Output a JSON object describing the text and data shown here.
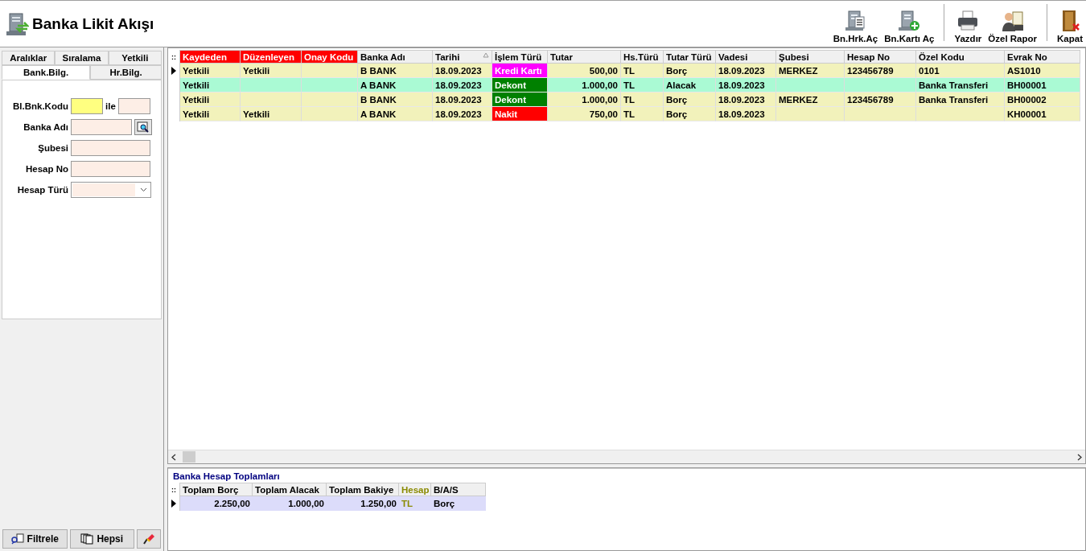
{
  "window": {
    "title": "Banka Likit Akışı"
  },
  "toolbar_groups": [
    [
      {
        "label": "Bn.Hrk.Aç",
        "kind": "bank"
      },
      {
        "label": "Bn.Kartı Aç",
        "kind": "bank-add"
      }
    ],
    [
      {
        "label": "Yazdır",
        "kind": "printer"
      },
      {
        "label": "Özel Rapor",
        "kind": "report"
      }
    ],
    [
      {
        "label": "Kapat",
        "kind": "door"
      }
    ]
  ],
  "sidebar": {
    "tabs_back": [
      {
        "label": "Aralıklar",
        "selected": false
      },
      {
        "label": "Sıralama",
        "selected": false
      },
      {
        "label": "Yetkili",
        "selected": false
      }
    ],
    "tabs_front": [
      {
        "label": "Bank.Bilg.",
        "selected": true
      },
      {
        "label": "Hr.Bilg.",
        "selected": false
      }
    ],
    "fields": [
      {
        "label": "Bl.Bnk.Kodu",
        "kind": "range",
        "joiner": "ile",
        "focused": true
      },
      {
        "label": "Banka Adı",
        "kind": "lookup",
        "focused": false
      },
      {
        "label": "Şubesi",
        "kind": "text",
        "focused": false
      },
      {
        "label": "Hesap No",
        "kind": "text",
        "focused": false
      },
      {
        "label": "Hesap Türü",
        "kind": "select",
        "focused": false
      }
    ],
    "buttons": [
      {
        "label": "Filtrele",
        "kind": "filter"
      },
      {
        "label": "Hepsi",
        "kind": "pages"
      },
      {
        "kind": "eraser"
      }
    ]
  },
  "table": {
    "corner": "::",
    "columns": [
      {
        "label": "Kaydeden",
        "flagged": true,
        "sorted": false,
        "kind": "text"
      },
      {
        "label": "Düzenleyen",
        "flagged": true,
        "sorted": false,
        "kind": "text"
      },
      {
        "label": "Onay Kodu",
        "flagged": true,
        "sorted": false,
        "kind": "text"
      },
      {
        "label": "Banka Adı",
        "flagged": false,
        "sorted": false,
        "kind": "text"
      },
      {
        "label": "Tarihi",
        "flagged": false,
        "sorted": true,
        "kind": "text"
      },
      {
        "label": "İşlem Türü",
        "flagged": false,
        "sorted": false,
        "kind": "tag"
      },
      {
        "label": "Tutar",
        "flagged": false,
        "sorted": false,
        "kind": "number"
      },
      {
        "label": "Hs.Türü",
        "flagged": false,
        "sorted": false,
        "kind": "text"
      },
      {
        "label": "Tutar Türü",
        "flagged": false,
        "sorted": false,
        "kind": "text"
      },
      {
        "label": "Vadesi",
        "flagged": false,
        "sorted": false,
        "kind": "text"
      },
      {
        "label": "Şubesi",
        "flagged": false,
        "sorted": false,
        "kind": "text"
      },
      {
        "label": "Hesap No",
        "flagged": false,
        "sorted": false,
        "kind": "text"
      },
      {
        "label": "Özel Kodu",
        "flagged": false,
        "sorted": false,
        "kind": "text"
      },
      {
        "label": "Evrak No",
        "flagged": false,
        "sorted": false,
        "kind": "text"
      }
    ],
    "rows": [
      {
        "selected": true,
        "color": "#f2f2bb",
        "cells": [
          "Yetkili",
          "Yetkili",
          "",
          "B BANK",
          "18.09.2023",
          {
            "text": "Kredi Kartı",
            "color": "#ff00ff"
          },
          "500,00",
          "TL",
          "Borç",
          "18.09.2023",
          "MERKEZ",
          "123456789",
          "0101",
          "AS1010"
        ]
      },
      {
        "selected": false,
        "color": "#aafad4",
        "cells": [
          "Yetkili",
          "",
          "",
          "A BANK",
          "18.09.2023",
          {
            "text": "Dekont",
            "color": "#008000"
          },
          "1.000,00",
          "TL",
          "Alacak",
          "18.09.2023",
          "",
          "",
          "Banka Transferi",
          "BH00001"
        ]
      },
      {
        "selected": false,
        "color": "#f2f2bb",
        "cells": [
          "Yetkili",
          "",
          "",
          "B BANK",
          "18.09.2023",
          {
            "text": "Dekont",
            "color": "#008000"
          },
          "1.000,00",
          "TL",
          "Borç",
          "18.09.2023",
          "MERKEZ",
          "123456789",
          "Banka Transferi",
          "BH00002"
        ]
      },
      {
        "selected": false,
        "color": "#f2f2bb",
        "cells": [
          "Yetkili",
          "Yetkili",
          "",
          "A BANK",
          "18.09.2023",
          {
            "text": "Nakit",
            "color": "#ff0000"
          },
          "750,00",
          "TL",
          "Borç",
          "18.09.2023",
          "",
          "",
          "",
          "KH00001"
        ]
      }
    ]
  },
  "totals": {
    "title": "Banka Hesap Toplamları",
    "corner": "::",
    "columns": [
      {
        "label": "Toplam Borç",
        "kind": "number",
        "accent": false
      },
      {
        "label": "Toplam Alacak",
        "kind": "number",
        "accent": false
      },
      {
        "label": "Toplam Bakiye",
        "kind": "number",
        "accent": false
      },
      {
        "label": "Hesap",
        "kind": "text",
        "accent": true
      },
      {
        "label": "B/A/S",
        "kind": "text",
        "accent": false
      }
    ],
    "rows": [
      {
        "selected": true,
        "cells": [
          "2.250,00",
          "1.000,00",
          "1.250,00",
          "TL",
          "Borç"
        ]
      }
    ]
  }
}
